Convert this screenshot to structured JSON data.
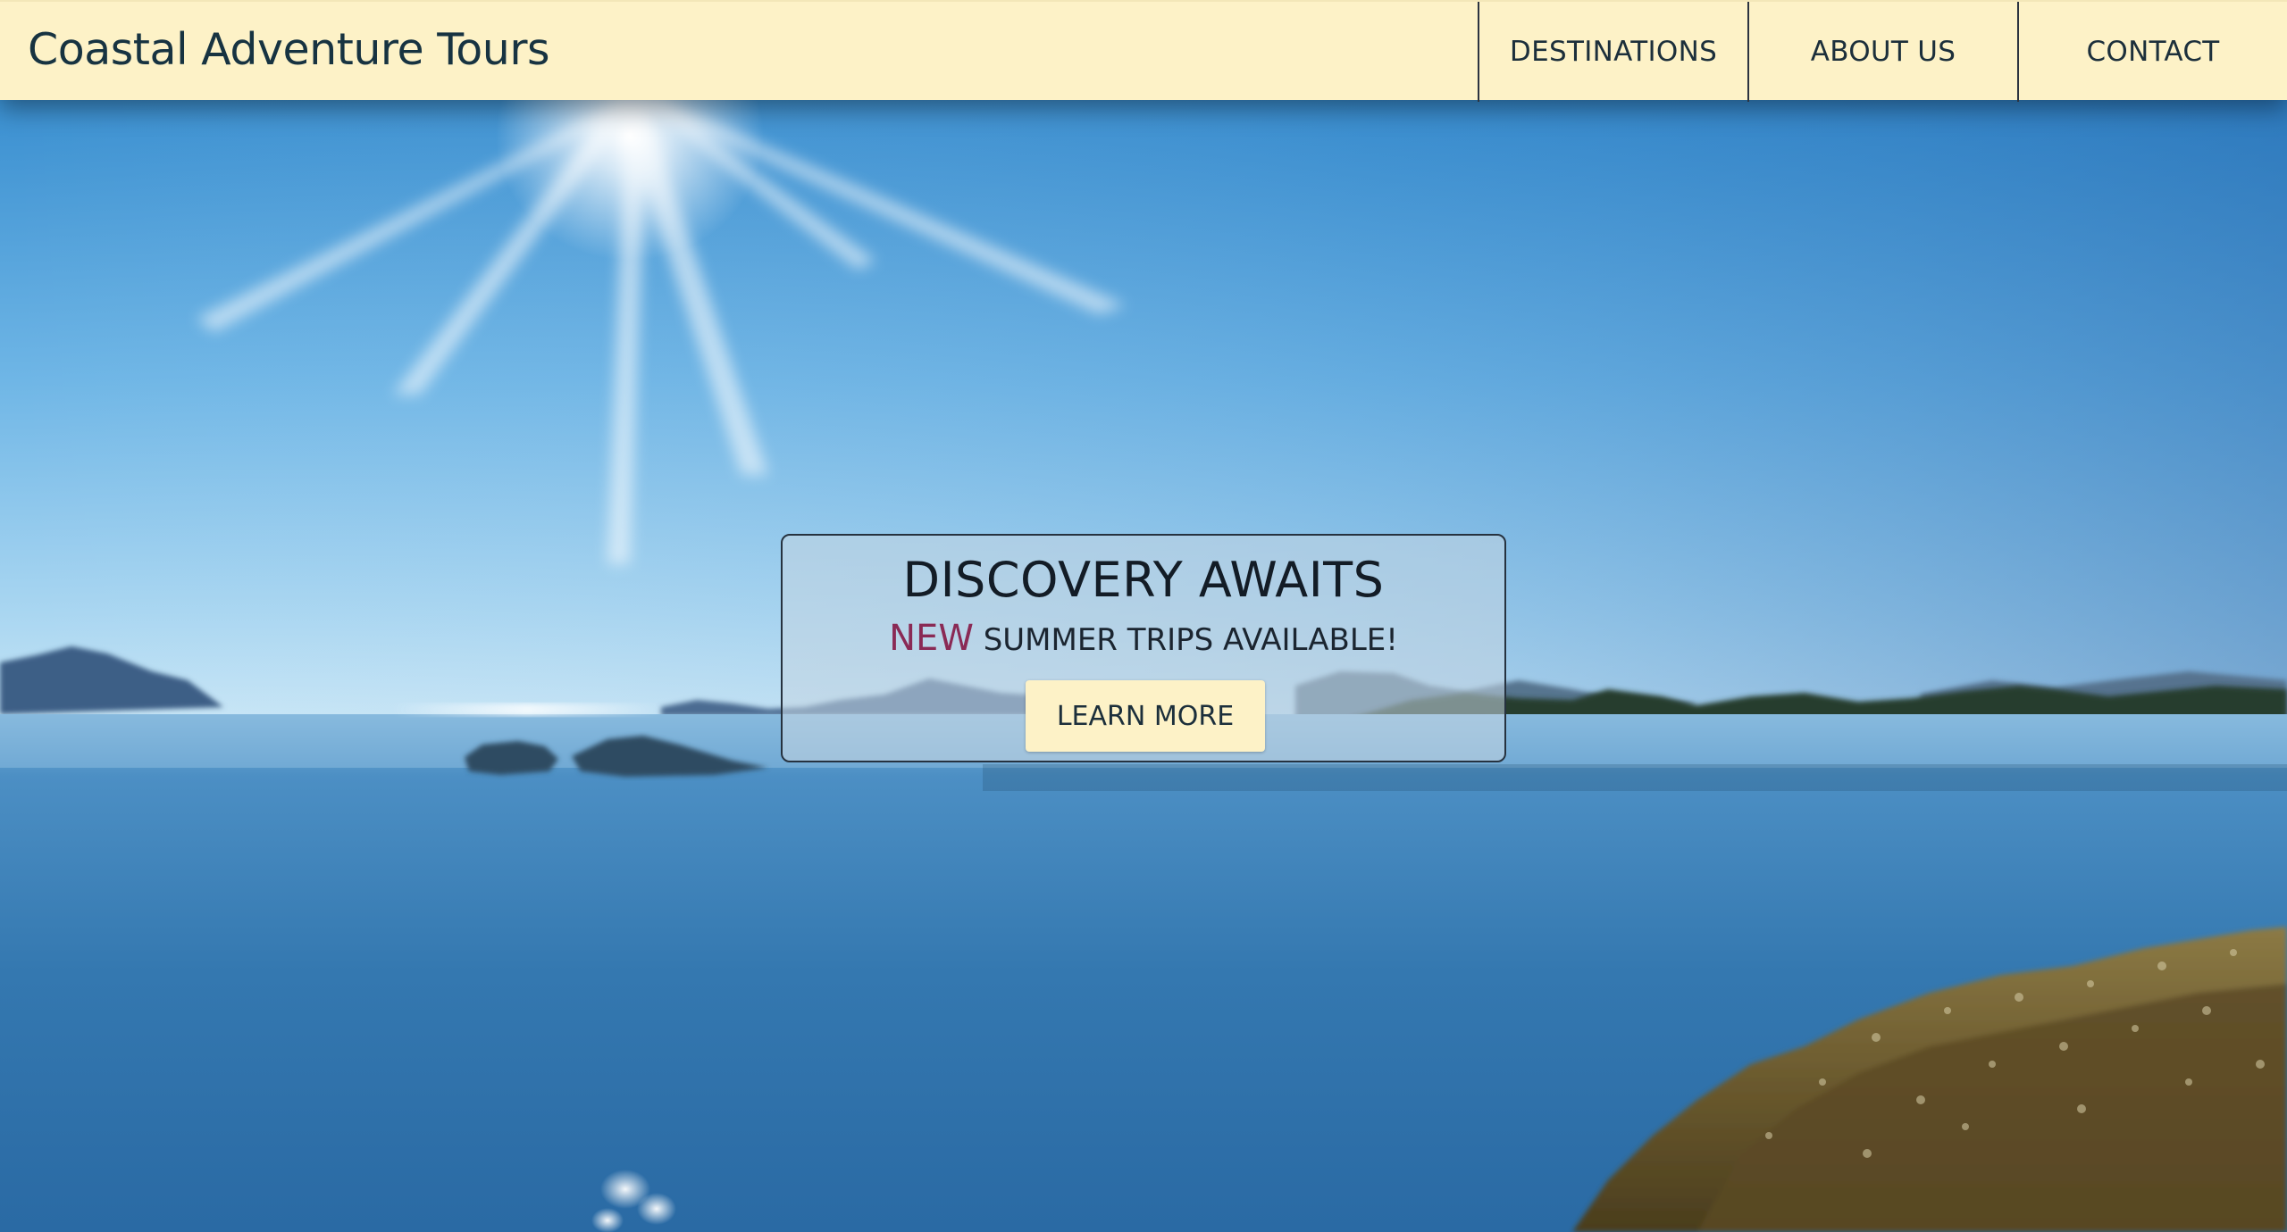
{
  "header": {
    "brand": "Coastal Adventure Tours",
    "nav": [
      {
        "label": "DESTINATIONS"
      },
      {
        "label": "ABOUT US"
      },
      {
        "label": "CONTACT"
      }
    ]
  },
  "hero": {
    "promo": {
      "title": "DISCOVERY AWAITS",
      "highlight": "NEW",
      "subtitle_rest": "SUMMER TRIPS AVAILABLE!",
      "button_label": "LEARN MORE"
    }
  },
  "colors": {
    "header_bg": "#fdf2c7",
    "brand_text": "#173341",
    "highlight": "#8a2a55",
    "button_bg": "#fdf2c7"
  }
}
